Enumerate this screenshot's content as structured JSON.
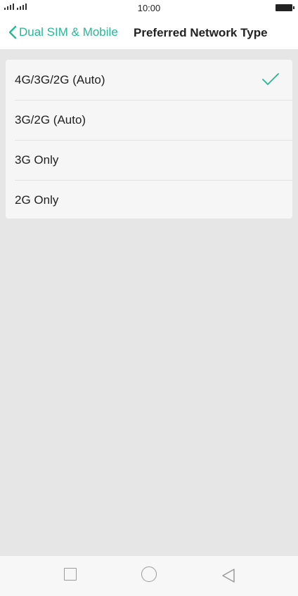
{
  "status_bar": {
    "time": "10:00"
  },
  "header": {
    "back_label": "Dual SIM & Mobile",
    "title": "Preferred Network Type"
  },
  "options": [
    {
      "label": "4G/3G/2G (Auto)",
      "selected": true
    },
    {
      "label": "3G/2G (Auto)",
      "selected": false
    },
    {
      "label": "3G Only",
      "selected": false
    },
    {
      "label": "2G Only",
      "selected": false
    }
  ],
  "colors": {
    "accent": "#25b895",
    "background": "#e6e6e6",
    "card": "#f6f6f6"
  },
  "nav_bar": {
    "icons": [
      "recents-icon",
      "home-icon",
      "back-icon"
    ]
  }
}
